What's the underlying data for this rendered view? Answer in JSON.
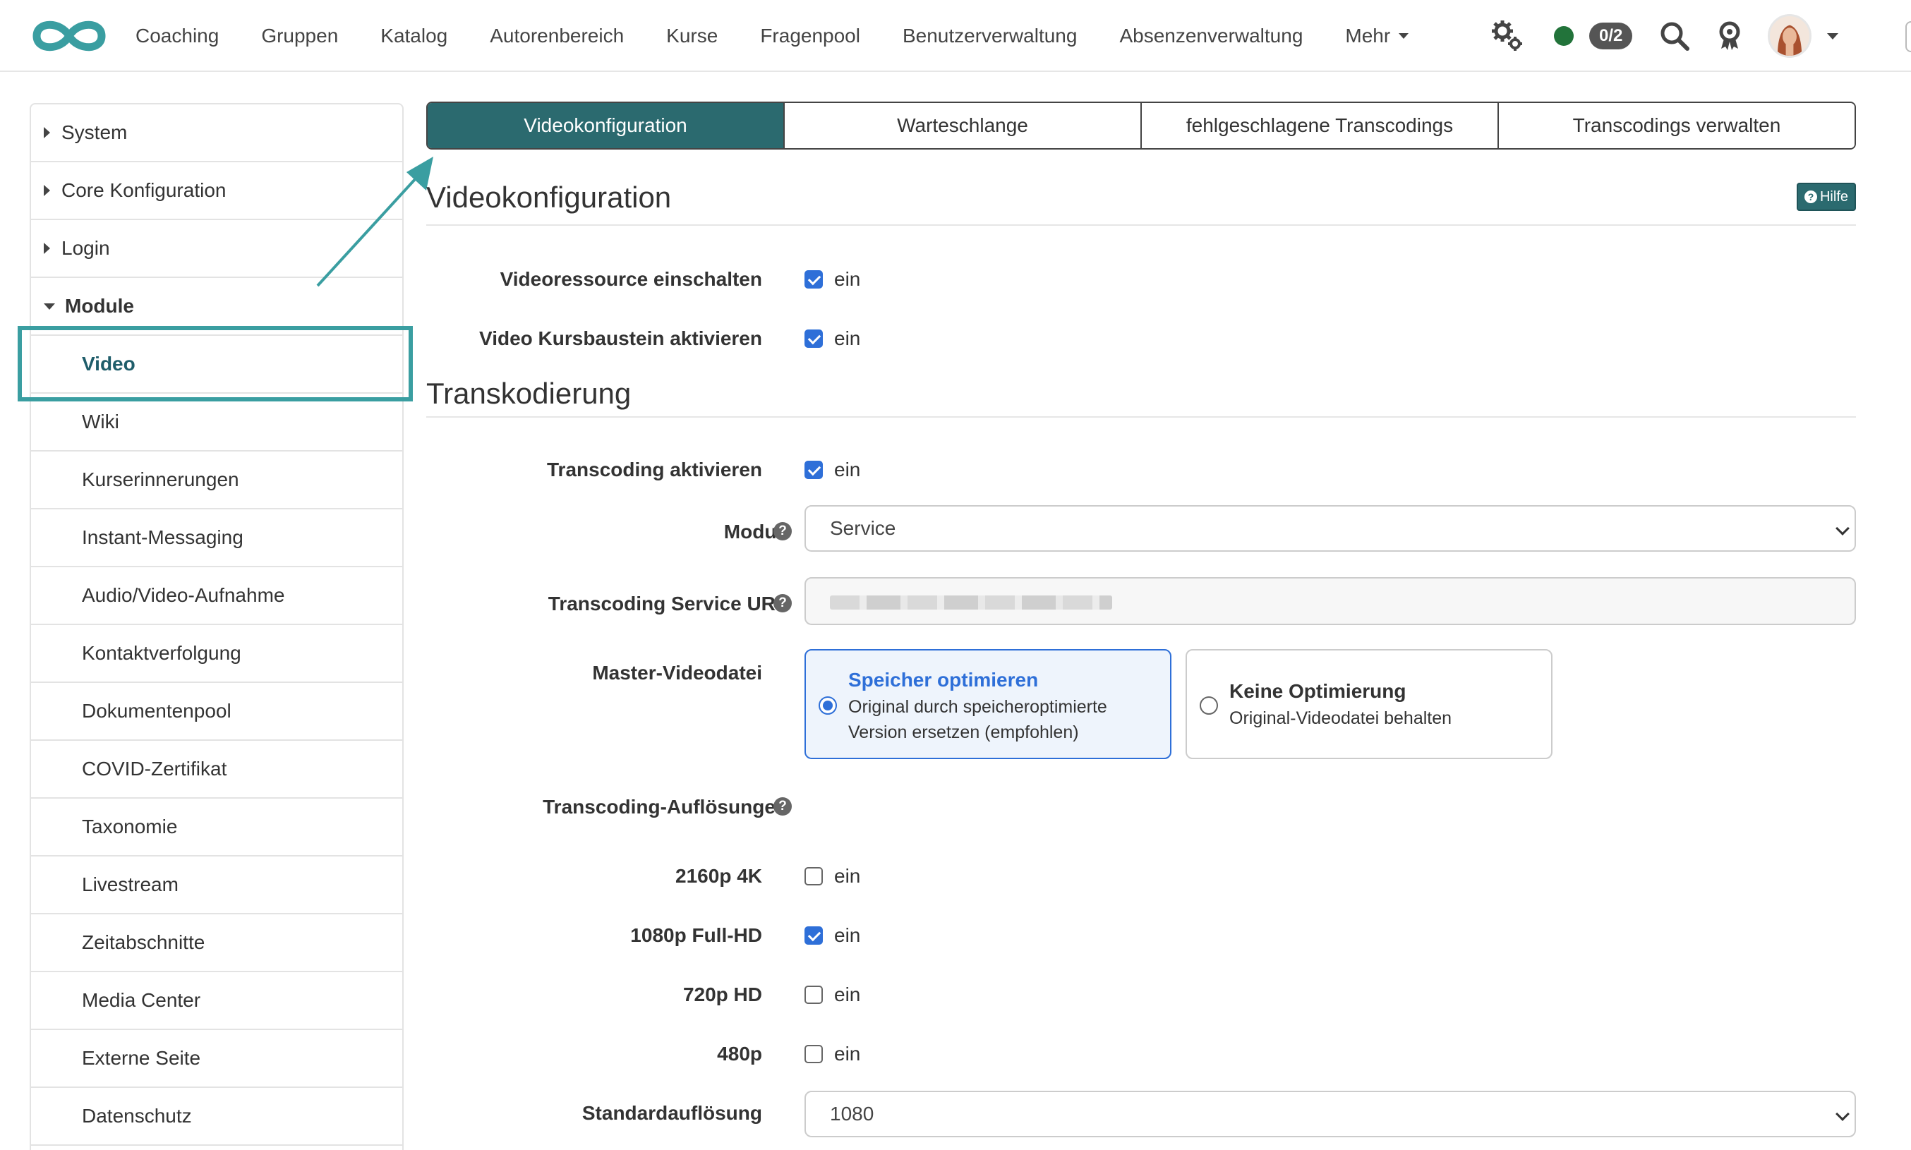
{
  "topnav": {
    "items": [
      "Coaching",
      "Gruppen",
      "Katalog",
      "Autorenbereich",
      "Kurse",
      "Fragenpool",
      "Benutzerverwaltung",
      "Absenzenverwaltung",
      "Mehr"
    ],
    "counter_badge": "0/2",
    "logo_color": "#3a9ea1",
    "status_color": "#22733a"
  },
  "sidebar": {
    "top_items": [
      "System",
      "Core Konfiguration",
      "Login"
    ],
    "module_label": "Module",
    "sub_items": [
      "Video",
      "Wiki",
      "Kurserinnerungen",
      "Instant-Messaging",
      "Audio/Video-Aufnahme",
      "Kontaktverfolgung",
      "Dokumentenpool",
      "COVID-Zertifikat",
      "Taxonomie",
      "Livestream",
      "Zeitabschnitte",
      "Media Center",
      "Externe Seite",
      "Datenschutz"
    ]
  },
  "tabs": [
    "Videokonfiguration",
    "Warteschlange",
    "fehlgeschlagene Transcodings",
    "Transcodings verwalten"
  ],
  "section_video": {
    "title": "Videokonfiguration",
    "help_label": "Hilfe",
    "rows": [
      {
        "label": "Videoressource einschalten",
        "value": "ein",
        "checked": true
      },
      {
        "label": "Video Kursbaustein aktivieren",
        "value": "ein",
        "checked": true
      }
    ]
  },
  "section_transcoding": {
    "title": "Transkodierung",
    "enable": {
      "label": "Transcoding aktivieren",
      "value": "ein",
      "checked": true
    },
    "modus": {
      "label": "Modus",
      "value": "Service"
    },
    "service_url": {
      "label": "Transcoding Service URL"
    },
    "master": {
      "label": "Master-Videodatei",
      "option_selected": {
        "title": "Speicher optimieren",
        "desc": "Original durch speicheroptimierte Version ersetzen (empfohlen)"
      },
      "option_other": {
        "title": "Keine Optimierung",
        "desc": "Original-Videodatei behalten"
      }
    },
    "resolutions_label": "Transcoding-Auflösungen",
    "resolutions": [
      {
        "label": "2160p 4K",
        "value": "ein",
        "checked": false
      },
      {
        "label": "1080p Full-HD",
        "value": "ein",
        "checked": true
      },
      {
        "label": "720p HD",
        "value": "ein",
        "checked": false
      },
      {
        "label": "480p",
        "value": "ein",
        "checked": false
      }
    ],
    "default_res": {
      "label": "Standardauflösung",
      "value": "1080"
    }
  },
  "colors": {
    "accent": "#2b6a6f",
    "highlight": "#3a9ea1",
    "checkbox": "#2e6fd8"
  }
}
